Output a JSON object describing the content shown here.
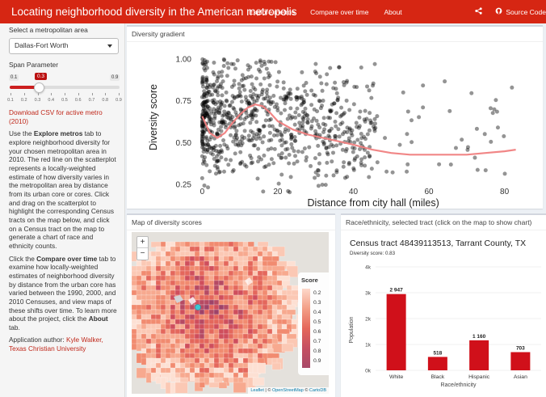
{
  "nav": {
    "title": "Locating neighborhood diversity in the American metropolis",
    "links": [
      "Explore metros",
      "Compare over time",
      "About"
    ],
    "source_label": "Source Code",
    "bg_color": "#d62613"
  },
  "sidebar": {
    "metro_label": "Select a metropolitan area",
    "metro_value": "Dallas-Fort Worth",
    "span_label": "Span Parameter",
    "span_min": "0.1",
    "span_max": "0.9",
    "span_value": "0.3",
    "span_ticks": [
      "0.1",
      "0.2",
      "0.3",
      "0.4",
      "0.5",
      "0.6",
      "0.7",
      "0.8",
      "0.9"
    ],
    "download_label": "Download CSV for active metro (2010)",
    "p1_a": "Use the ",
    "p1_b": "Explore metros",
    "p1_c": " tab to explore neighborhood diversity for your chosen metropolitan area in 2010. The red line on the scatterplot represents a locally-weighted estimate of how diversity varies in the metropolitan area by distance from its urban core or cores. Click and drag on the scatterplot to highlight the corresponding Census tracts on the map below, and click on a Census tract on the map to generate a chart of race and ethnicity counts.",
    "p2_a": "Click the ",
    "p2_b": "Compare over time",
    "p2_c": " tab to examine how locally-weighted estimates of neighborhood diversity by distance from the urban core has varied between the 1990, 2000, and 2010 Censuses, and view maps of these shifts over time. To learn more about the project, click the ",
    "p2_d": "About",
    "p2_e": " tab.",
    "author_label": "Application author: ",
    "author_name": "Kyle Walker, Texas Christian University"
  },
  "gradient": {
    "header": "Diversity gradient",
    "chart_data": {
      "type": "scatter",
      "xlabel": "Distance from city hall (miles)",
      "ylabel": "Diversity score",
      "xlim": [
        -2,
        85
      ],
      "ylim": [
        0.18,
        1.05
      ],
      "xticks": [
        0,
        20,
        40,
        60,
        80
      ],
      "yticks": [
        0.25,
        0.5,
        0.75,
        1.0
      ],
      "ytick_labels": [
        "0.25",
        "0.50",
        "0.75",
        "1.00"
      ],
      "point_color": "#000000",
      "smooth_color": "#f08080",
      "smooth_line": {
        "x": [
          0,
          2,
          4,
          6,
          8,
          10,
          12,
          14,
          16,
          18,
          20,
          24,
          28,
          32,
          36,
          40,
          45,
          50,
          55,
          60,
          65,
          70,
          75,
          80,
          83
        ],
        "y": [
          0.66,
          0.56,
          0.53,
          0.56,
          0.62,
          0.67,
          0.71,
          0.73,
          0.72,
          0.68,
          0.63,
          0.58,
          0.55,
          0.53,
          0.51,
          0.49,
          0.46,
          0.44,
          0.43,
          0.43,
          0.43,
          0.43,
          0.44,
          0.45,
          0.46
        ]
      }
    }
  },
  "map": {
    "header": "Map of diversity scores",
    "zoom_in": "+",
    "zoom_out": "−",
    "legend_title": "Score",
    "legend_labels": [
      "0.2",
      "0.3",
      "0.4",
      "0.5",
      "0.6",
      "0.7",
      "0.8",
      "0.9"
    ],
    "attr_leaflet": "Leaflet",
    "attr_sep": " | © ",
    "attr_osm": "OpenStreetMap",
    "attr_sep2": " © ",
    "attr_carto": "CartoDB"
  },
  "race": {
    "header": "Race/ethnicity, selected tract (click on the map to show chart)",
    "title": "Census tract 48439113513, Tarrant County, TX",
    "subtitle": "Diversity score: 0.83",
    "chart_data": {
      "type": "bar",
      "categories": [
        "White",
        "Black",
        "Hispanic",
        "Asian"
      ],
      "values": [
        2947,
        518,
        1160,
        703
      ],
      "value_labels": [
        "2 947",
        "518",
        "1 160",
        "703"
      ],
      "xlabel": "Race/ethnicity",
      "ylabel": "Population",
      "ylim": [
        0,
        4000
      ],
      "yticks": [
        0,
        1000,
        2000,
        3000,
        4000
      ],
      "ytick_labels": [
        "0k",
        "1k",
        "2k",
        "3k",
        "4k"
      ],
      "bar_color": "#d0101a"
    }
  }
}
